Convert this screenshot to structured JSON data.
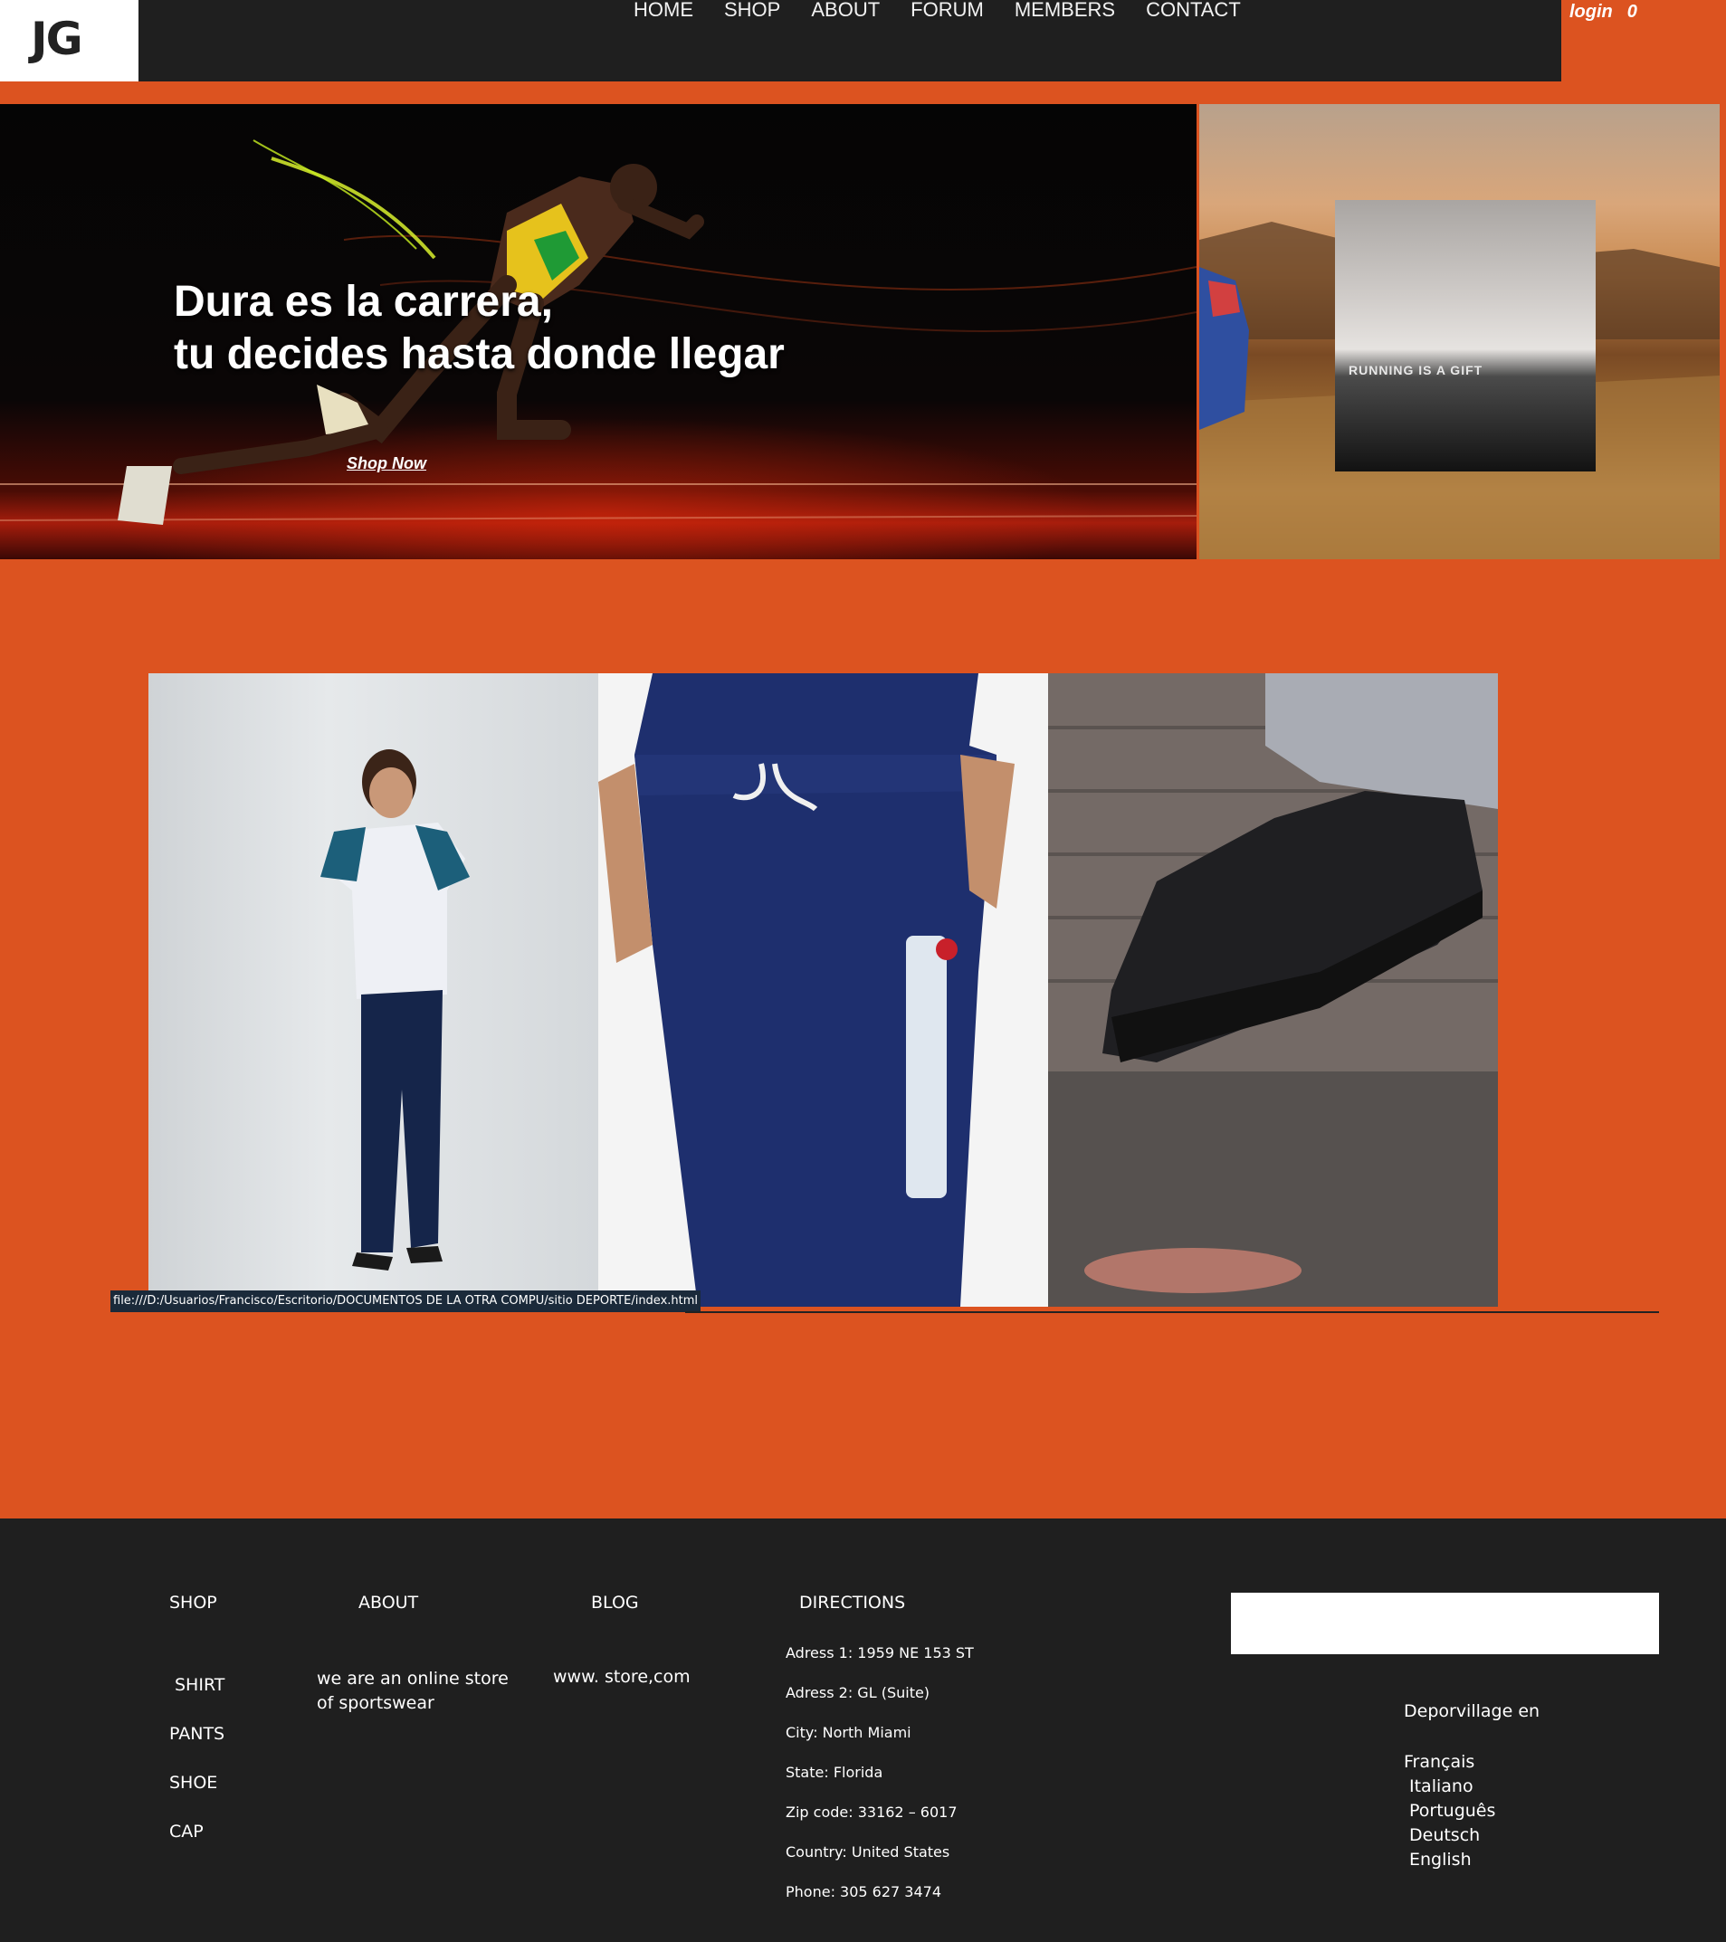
{
  "header": {
    "logo_text": "JG",
    "nav": [
      "HOME",
      "SHOP",
      "ABOUT",
      "FORUM",
      "MEMBERS",
      "CONTACT"
    ],
    "login_label": "login",
    "cart_count": "0"
  },
  "hero": {
    "headline_line1": "Dura es la carrera,",
    "headline_line2": "tu decides hasta donde llegar",
    "cta": "Shop Now",
    "side_caption": "RUNNING IS A GIFT"
  },
  "status_bar": {
    "url": "file:///D:/Usuarios/Francisco/Escritorio/DOCUMENTOS DE LA OTRA COMPU/sitio DEPORTE/index.html"
  },
  "footer": {
    "shop": {
      "heading": "SHOP",
      "items": [
        "SHIRT",
        "PANTS",
        "SHOE",
        "CAP"
      ]
    },
    "about": {
      "heading": "ABOUT",
      "text": "we are an online store of sportswear"
    },
    "blog": {
      "heading": "BLOG",
      "text": "www. store,com"
    },
    "directions": {
      "heading": "DIRECTIONS",
      "lines": [
        "Adress 1: 1959 NE 153 ST",
        "Adress 2: GL (Suite)",
        "City: North Miami",
        "State: Florida",
        "Zip code: 33162 – 6017",
        "Country: United States",
        "Phone: 305 627 3474"
      ]
    },
    "language": {
      "title": "Deporvillage en",
      "options": [
        "Français",
        "Italiano",
        "Português",
        "Deutsch",
        "English"
      ]
    }
  },
  "colors": {
    "accent": "#dc5320",
    "dark": "#1f1f1f"
  }
}
